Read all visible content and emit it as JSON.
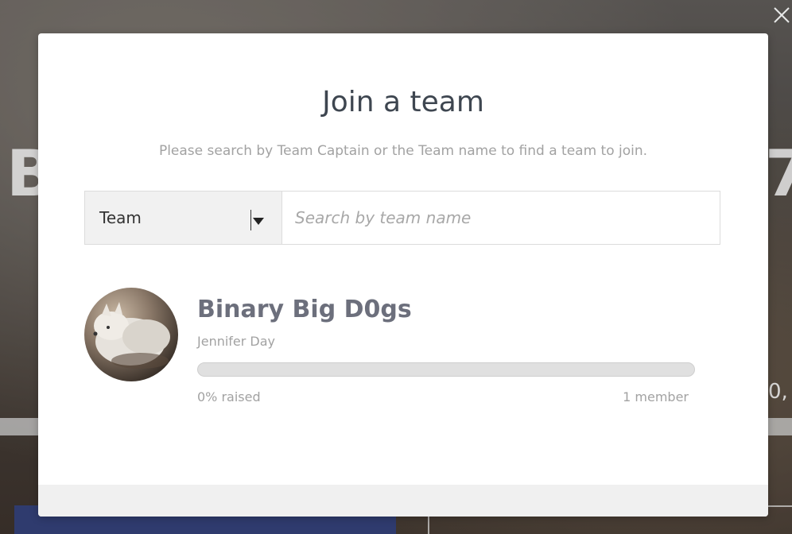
{
  "background": {
    "left_fragment": "B",
    "right_fragment": "7",
    "right_small_fragment": "0,"
  },
  "modal": {
    "title": "Join a team",
    "subtitle": "Please search by Team Captain or the Team name to find a team to join.",
    "close_icon": "close-icon"
  },
  "search": {
    "type_selected": "Team",
    "type_icon": "caret-down-icon",
    "placeholder": "Search by team name",
    "value": ""
  },
  "results": [
    {
      "team_name": "Binary Big D0gs",
      "captain": "Jennifer Day",
      "progress_percent": 0,
      "raised_label": "0% raised",
      "members_label": "1 member",
      "avatar_icon": "team-avatar-image"
    }
  ],
  "colors": {
    "title": "#3e4650",
    "team_name": "#6c6f7c",
    "muted": "#a2a2a2",
    "progress_fill": "#4a9be0"
  }
}
